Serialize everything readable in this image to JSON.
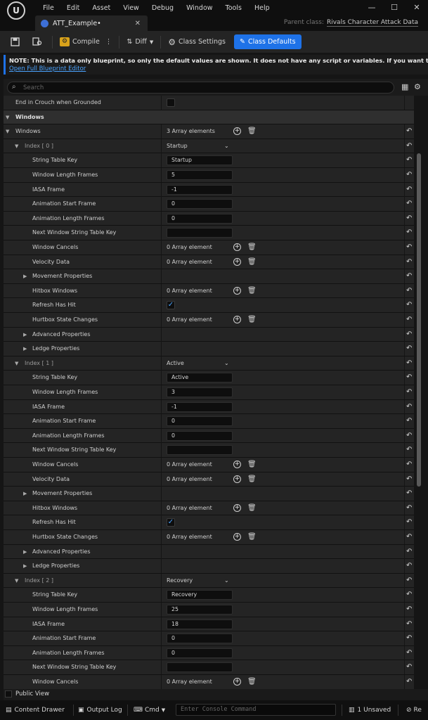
{
  "menu": [
    "File",
    "Edit",
    "Asset",
    "View",
    "Debug",
    "Window",
    "Tools",
    "Help"
  ],
  "logo_text": "U",
  "window_controls": {
    "minimize": "—",
    "maximize": "☐",
    "close": "✕"
  },
  "tab": {
    "name": "ATT_Example•",
    "close": "✕"
  },
  "parent_class": {
    "label": "Parent class:",
    "value": "Rivals Character Attack Data"
  },
  "toolbar": {
    "compile": "Compile",
    "diff": "Diff",
    "class_settings": "Class Settings",
    "class_defaults": "Class Defaults"
  },
  "notice": {
    "text": "NOTE: This is a data only blueprint, so only the default values are shown.  It does not have any script or variables.  If you want to add som",
    "link": "Open Full Blueprint Editor"
  },
  "search": {
    "placeholder": "Search"
  },
  "rows": [
    {
      "label": "End in Crouch when Grounded",
      "indent": 17,
      "type": "checkbox",
      "checked": false
    },
    {
      "label": "Windows",
      "indent": 17,
      "type": "category"
    },
    {
      "label": "Windows",
      "indent": 17,
      "twist": true,
      "type": "array",
      "value": "3 Array elements",
      "reset": true
    },
    {
      "label": "Index [ 0 ]",
      "indent": 30,
      "twist": true,
      "type": "dropdown",
      "value": "Startup",
      "index": true,
      "reset": true
    },
    {
      "label": "String Table Key",
      "indent": 41,
      "type": "input",
      "value": "Startup",
      "reset": true
    },
    {
      "label": "Window Length Frames",
      "indent": 41,
      "type": "input",
      "value": "5",
      "reset": true
    },
    {
      "label": "IASA Frame",
      "indent": 41,
      "type": "input",
      "value": "-1",
      "reset": true
    },
    {
      "label": "Animation Start Frame",
      "indent": 41,
      "type": "input",
      "value": "0",
      "reset": true
    },
    {
      "label": "Animation Length Frames",
      "indent": 41,
      "type": "input",
      "value": "0",
      "reset": true
    },
    {
      "label": "Next Window String Table Key",
      "indent": 41,
      "type": "input",
      "value": "",
      "reset": true
    },
    {
      "label": "Window Cancels",
      "indent": 41,
      "type": "array",
      "value": "0 Array element",
      "reset": true
    },
    {
      "label": "Velocity Data",
      "indent": 41,
      "type": "array",
      "value": "0 Array element",
      "reset": true
    },
    {
      "label": "Movement Properties",
      "indent": 41,
      "twistc": true,
      "type": "none",
      "reset": true
    },
    {
      "label": "Hitbox Windows",
      "indent": 41,
      "type": "array",
      "value": "0 Array element",
      "reset": true
    },
    {
      "label": "Refresh Has Hit",
      "indent": 41,
      "type": "checkbox",
      "checked": true,
      "reset": true
    },
    {
      "label": "Hurtbox State Changes",
      "indent": 41,
      "type": "array",
      "value": "0 Array element",
      "reset": true
    },
    {
      "label": "Advanced Properties",
      "indent": 41,
      "twistc": true,
      "type": "none",
      "reset": true
    },
    {
      "label": "Ledge Properties",
      "indent": 41,
      "twistc": true,
      "type": "none",
      "reset": true
    },
    {
      "label": "Index [ 1 ]",
      "indent": 30,
      "twist": true,
      "type": "dropdown",
      "value": "Active",
      "index": true,
      "reset": true
    },
    {
      "label": "String Table Key",
      "indent": 41,
      "type": "input",
      "value": "Active",
      "reset": true
    },
    {
      "label": "Window Length Frames",
      "indent": 41,
      "type": "input",
      "value": "3",
      "reset": true
    },
    {
      "label": "IASA Frame",
      "indent": 41,
      "type": "input",
      "value": "-1",
      "reset": true
    },
    {
      "label": "Animation Start Frame",
      "indent": 41,
      "type": "input",
      "value": "0",
      "reset": true
    },
    {
      "label": "Animation Length Frames",
      "indent": 41,
      "type": "input",
      "value": "0",
      "reset": true
    },
    {
      "label": "Next Window String Table Key",
      "indent": 41,
      "type": "input",
      "value": "",
      "reset": true
    },
    {
      "label": "Window Cancels",
      "indent": 41,
      "type": "array",
      "value": "0 Array element",
      "reset": true
    },
    {
      "label": "Velocity Data",
      "indent": 41,
      "type": "array",
      "value": "0 Array element",
      "reset": true
    },
    {
      "label": "Movement Properties",
      "indent": 41,
      "twistc": true,
      "type": "none",
      "reset": true
    },
    {
      "label": "Hitbox Windows",
      "indent": 41,
      "type": "array",
      "value": "0 Array element",
      "reset": true
    },
    {
      "label": "Refresh Has Hit",
      "indent": 41,
      "type": "checkbox",
      "checked": true,
      "reset": true
    },
    {
      "label": "Hurtbox State Changes",
      "indent": 41,
      "type": "array",
      "value": "0 Array element",
      "reset": true
    },
    {
      "label": "Advanced Properties",
      "indent": 41,
      "twistc": true,
      "type": "none",
      "reset": true
    },
    {
      "label": "Ledge Properties",
      "indent": 41,
      "twistc": true,
      "type": "none",
      "reset": true
    },
    {
      "label": "Index [ 2 ]",
      "indent": 30,
      "twist": true,
      "type": "dropdown",
      "value": "Recovery",
      "index": true,
      "reset": true
    },
    {
      "label": "String Table Key",
      "indent": 41,
      "type": "input",
      "value": "Recovery",
      "reset": true
    },
    {
      "label": "Window Length Frames",
      "indent": 41,
      "type": "input",
      "value": "25",
      "reset": true
    },
    {
      "label": "IASA Frame",
      "indent": 41,
      "type": "input",
      "value": "18",
      "reset": true
    },
    {
      "label": "Animation Start Frame",
      "indent": 41,
      "type": "input",
      "value": "0",
      "reset": true
    },
    {
      "label": "Animation Length Frames",
      "indent": 41,
      "type": "input",
      "value": "0",
      "reset": true
    },
    {
      "label": "Next Window String Table Key",
      "indent": 41,
      "type": "input",
      "value": "",
      "reset": true
    },
    {
      "label": "Window Cancels",
      "indent": 41,
      "type": "array",
      "value": "0 Array element",
      "reset": true
    }
  ],
  "public_view": "Public View",
  "statusbar": {
    "content_drawer": "Content Drawer",
    "output_log": "Output Log",
    "cmd": "Cmd",
    "console_placeholder": "Enter Console Command",
    "unsaved": "1 Unsaved",
    "revision": "Re"
  }
}
